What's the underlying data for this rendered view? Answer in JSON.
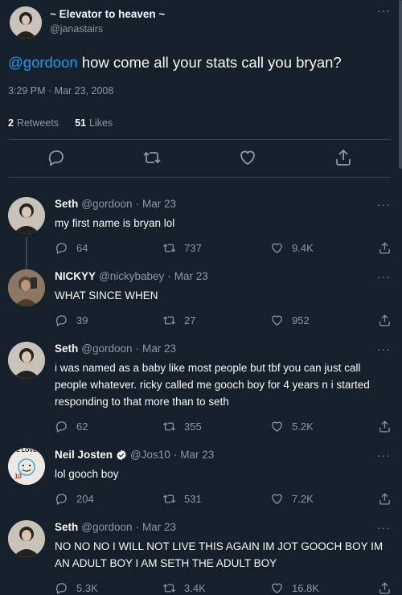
{
  "tweet": {
    "display_name": "~ Elevator to heaven ~",
    "handle": "@janastairs",
    "mention": "@gordoon",
    "text": " how come all your stats call you bryan?",
    "timestamp": "3:29 PM · Mar 23, 2008",
    "retweets_count": "2",
    "retweets_label": "Retweets",
    "likes_count": "51",
    "likes_label": "Likes"
  },
  "replies": [
    {
      "name": "Seth",
      "handle": "@gordoon",
      "date": "Mar 23",
      "text": "my first name is bryan lol",
      "replies": "64",
      "retweets": "737",
      "likes": "9.4K",
      "avatar": "seth"
    },
    {
      "name": "NICKYY",
      "handle": "@nickybabey",
      "date": "Mar 23",
      "text": "WHAT SINCE WHEN",
      "replies": "39",
      "retweets": "27",
      "likes": "952",
      "avatar": "nicky"
    },
    {
      "name": "Seth",
      "handle": "@gordoon",
      "date": "Mar 23",
      "text": "i was named as a baby like most people but tbf you can just call people whatever. ricky called me gooch boy for 4 years n i started responding to that more than to seth",
      "replies": "62",
      "retweets": "355",
      "likes": "5.2K",
      "avatar": "seth"
    },
    {
      "name": "Neil Josten",
      "handle": "@Jos10",
      "date": "Mar 23",
      "text": "lol gooch boy",
      "replies": "204",
      "retweets": "531",
      "likes": "7.2K",
      "avatar": "neil",
      "verified": true,
      "avatar_text": {
        "top": "E LOVE",
        "number": "10"
      }
    },
    {
      "name": "Seth",
      "handle": "@gordoon",
      "date": "Mar 23",
      "text": "NO NO NO I WILL NOT LIVE THIS AGAIN IM JOT GOOCH BOY IM AN ADULT BOY I AM SETH THE ADULT BOY",
      "replies": "5.3K",
      "retweets": "3.4K",
      "likes": "16.8K",
      "avatar": "seth"
    }
  ],
  "colors": {
    "background": "#15202b",
    "accent": "#1d9bf0",
    "muted": "#8b98a5",
    "text": "#f7f9f9",
    "divider": "#38444d"
  },
  "icons": [
    "more-icon",
    "reply-icon",
    "retweet-icon",
    "like-icon",
    "share-icon",
    "verified-icon"
  ]
}
